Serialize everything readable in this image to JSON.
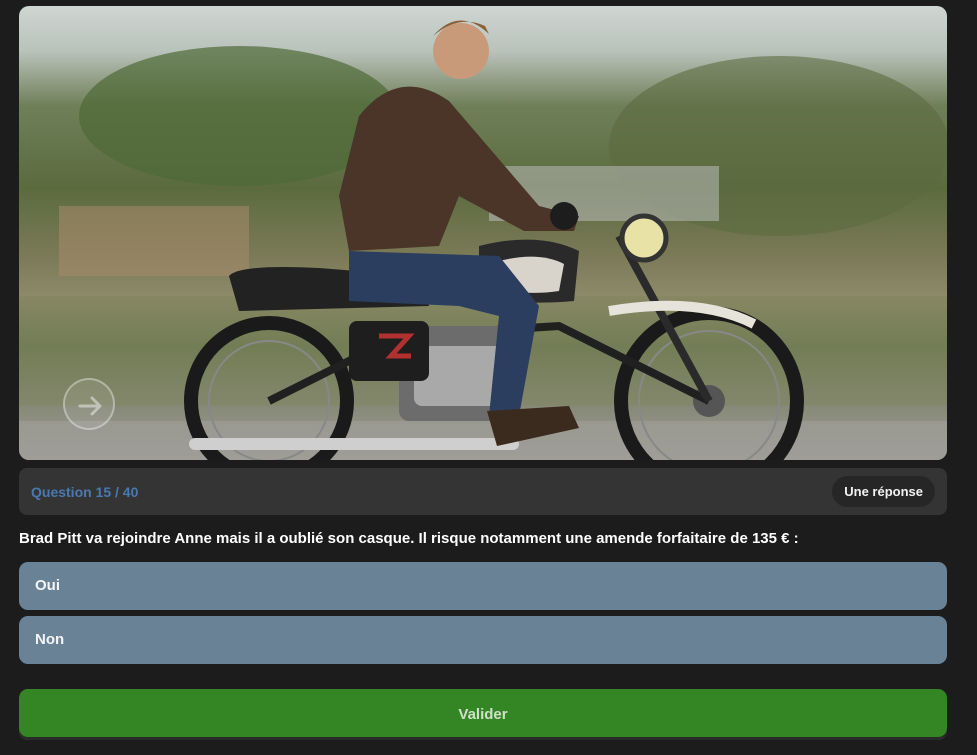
{
  "quiz": {
    "progress_label": "Question 15 / 40",
    "answer_type": "Une réponse",
    "question": "Brad Pitt va rejoindre Anne mais il a oublié son casque. Il risque notamment une amende forfaitaire de 135 € :",
    "answers": [
      {
        "label": "Oui"
      },
      {
        "label": "Non"
      }
    ],
    "submit_label": "Valider"
  },
  "icons": {
    "photo_next": "arrow-right-icon"
  },
  "colors": {
    "background": "#1c1c1c",
    "answer_bg": "#6a8296",
    "submit_bg": "#338623",
    "progress_text": "#4a79b0"
  }
}
